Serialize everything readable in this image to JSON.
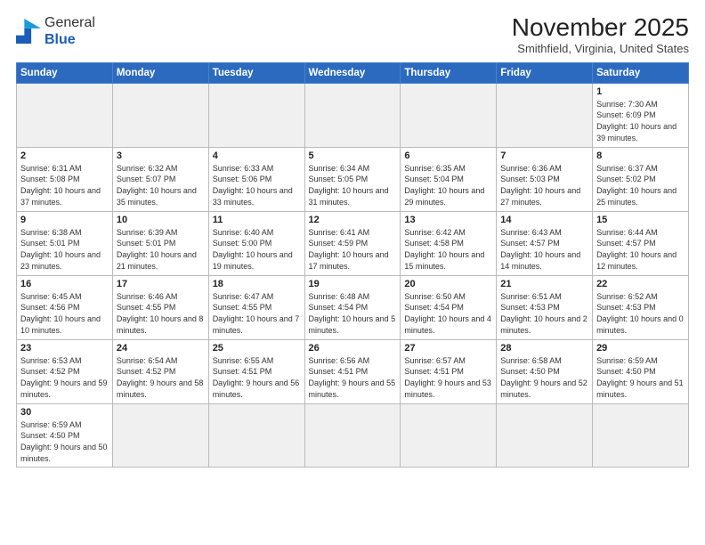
{
  "logo": {
    "general": "General",
    "blue": "Blue"
  },
  "header": {
    "month": "November 2025",
    "location": "Smithfield, Virginia, United States"
  },
  "days_of_week": [
    "Sunday",
    "Monday",
    "Tuesday",
    "Wednesday",
    "Thursday",
    "Friday",
    "Saturday"
  ],
  "weeks": [
    [
      {
        "day": "",
        "info": ""
      },
      {
        "day": "",
        "info": ""
      },
      {
        "day": "",
        "info": ""
      },
      {
        "day": "",
        "info": ""
      },
      {
        "day": "",
        "info": ""
      },
      {
        "day": "",
        "info": ""
      },
      {
        "day": "1",
        "info": "Sunrise: 7:30 AM\nSunset: 6:09 PM\nDaylight: 10 hours and 39 minutes."
      }
    ],
    [
      {
        "day": "2",
        "info": "Sunrise: 6:31 AM\nSunset: 5:08 PM\nDaylight: 10 hours and 37 minutes."
      },
      {
        "day": "3",
        "info": "Sunrise: 6:32 AM\nSunset: 5:07 PM\nDaylight: 10 hours and 35 minutes."
      },
      {
        "day": "4",
        "info": "Sunrise: 6:33 AM\nSunset: 5:06 PM\nDaylight: 10 hours and 33 minutes."
      },
      {
        "day": "5",
        "info": "Sunrise: 6:34 AM\nSunset: 5:05 PM\nDaylight: 10 hours and 31 minutes."
      },
      {
        "day": "6",
        "info": "Sunrise: 6:35 AM\nSunset: 5:04 PM\nDaylight: 10 hours and 29 minutes."
      },
      {
        "day": "7",
        "info": "Sunrise: 6:36 AM\nSunset: 5:03 PM\nDaylight: 10 hours and 27 minutes."
      },
      {
        "day": "8",
        "info": "Sunrise: 6:37 AM\nSunset: 5:02 PM\nDaylight: 10 hours and 25 minutes."
      }
    ],
    [
      {
        "day": "9",
        "info": "Sunrise: 6:38 AM\nSunset: 5:01 PM\nDaylight: 10 hours and 23 minutes."
      },
      {
        "day": "10",
        "info": "Sunrise: 6:39 AM\nSunset: 5:01 PM\nDaylight: 10 hours and 21 minutes."
      },
      {
        "day": "11",
        "info": "Sunrise: 6:40 AM\nSunset: 5:00 PM\nDaylight: 10 hours and 19 minutes."
      },
      {
        "day": "12",
        "info": "Sunrise: 6:41 AM\nSunset: 4:59 PM\nDaylight: 10 hours and 17 minutes."
      },
      {
        "day": "13",
        "info": "Sunrise: 6:42 AM\nSunset: 4:58 PM\nDaylight: 10 hours and 15 minutes."
      },
      {
        "day": "14",
        "info": "Sunrise: 6:43 AM\nSunset: 4:57 PM\nDaylight: 10 hours and 14 minutes."
      },
      {
        "day": "15",
        "info": "Sunrise: 6:44 AM\nSunset: 4:57 PM\nDaylight: 10 hours and 12 minutes."
      }
    ],
    [
      {
        "day": "16",
        "info": "Sunrise: 6:45 AM\nSunset: 4:56 PM\nDaylight: 10 hours and 10 minutes."
      },
      {
        "day": "17",
        "info": "Sunrise: 6:46 AM\nSunset: 4:55 PM\nDaylight: 10 hours and 8 minutes."
      },
      {
        "day": "18",
        "info": "Sunrise: 6:47 AM\nSunset: 4:55 PM\nDaylight: 10 hours and 7 minutes."
      },
      {
        "day": "19",
        "info": "Sunrise: 6:48 AM\nSunset: 4:54 PM\nDaylight: 10 hours and 5 minutes."
      },
      {
        "day": "20",
        "info": "Sunrise: 6:50 AM\nSunset: 4:54 PM\nDaylight: 10 hours and 4 minutes."
      },
      {
        "day": "21",
        "info": "Sunrise: 6:51 AM\nSunset: 4:53 PM\nDaylight: 10 hours and 2 minutes."
      },
      {
        "day": "22",
        "info": "Sunrise: 6:52 AM\nSunset: 4:53 PM\nDaylight: 10 hours and 0 minutes."
      }
    ],
    [
      {
        "day": "23",
        "info": "Sunrise: 6:53 AM\nSunset: 4:52 PM\nDaylight: 9 hours and 59 minutes."
      },
      {
        "day": "24",
        "info": "Sunrise: 6:54 AM\nSunset: 4:52 PM\nDaylight: 9 hours and 58 minutes."
      },
      {
        "day": "25",
        "info": "Sunrise: 6:55 AM\nSunset: 4:51 PM\nDaylight: 9 hours and 56 minutes."
      },
      {
        "day": "26",
        "info": "Sunrise: 6:56 AM\nSunset: 4:51 PM\nDaylight: 9 hours and 55 minutes."
      },
      {
        "day": "27",
        "info": "Sunrise: 6:57 AM\nSunset: 4:51 PM\nDaylight: 9 hours and 53 minutes."
      },
      {
        "day": "28",
        "info": "Sunrise: 6:58 AM\nSunset: 4:50 PM\nDaylight: 9 hours and 52 minutes."
      },
      {
        "day": "29",
        "info": "Sunrise: 6:59 AM\nSunset: 4:50 PM\nDaylight: 9 hours and 51 minutes."
      }
    ],
    [
      {
        "day": "30",
        "info": "Sunrise: 6:59 AM\nSunset: 4:50 PM\nDaylight: 9 hours and 50 minutes."
      },
      {
        "day": "",
        "info": ""
      },
      {
        "day": "",
        "info": ""
      },
      {
        "day": "",
        "info": ""
      },
      {
        "day": "",
        "info": ""
      },
      {
        "day": "",
        "info": ""
      },
      {
        "day": "",
        "info": ""
      }
    ]
  ]
}
